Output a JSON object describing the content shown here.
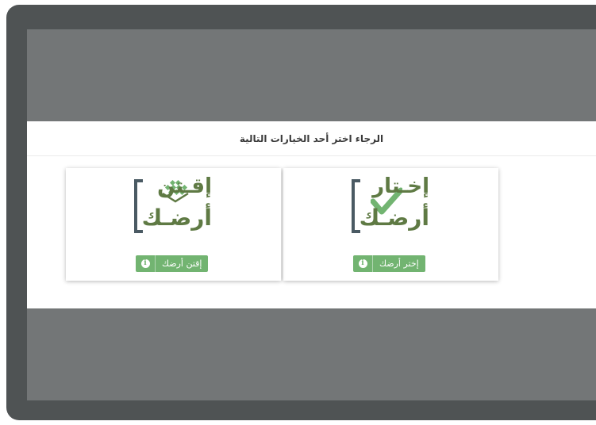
{
  "modal": {
    "title": "الرجاء اختر أحد الخيارات التالية"
  },
  "options": [
    {
      "id": "choose",
      "logo_top": "إخـتار",
      "logo_bottom": "أرضـك",
      "button_label": "إختر أرضك",
      "button_icon": "info-circle-icon",
      "logo_icon": "checkmark-icon"
    },
    {
      "id": "acquire",
      "logo_top": "إقـتن",
      "logo_bottom": "أرضـك",
      "button_label": "إقتن أرضك",
      "button_icon": "info-circle-icon",
      "logo_icon": "land-grid-icon"
    }
  ],
  "colors": {
    "frame": "#4f5354",
    "overlay": "#737677",
    "brand_green": "#72b471",
    "logo_green": "#5f7a44",
    "logo_dark": "#4a5a63"
  }
}
